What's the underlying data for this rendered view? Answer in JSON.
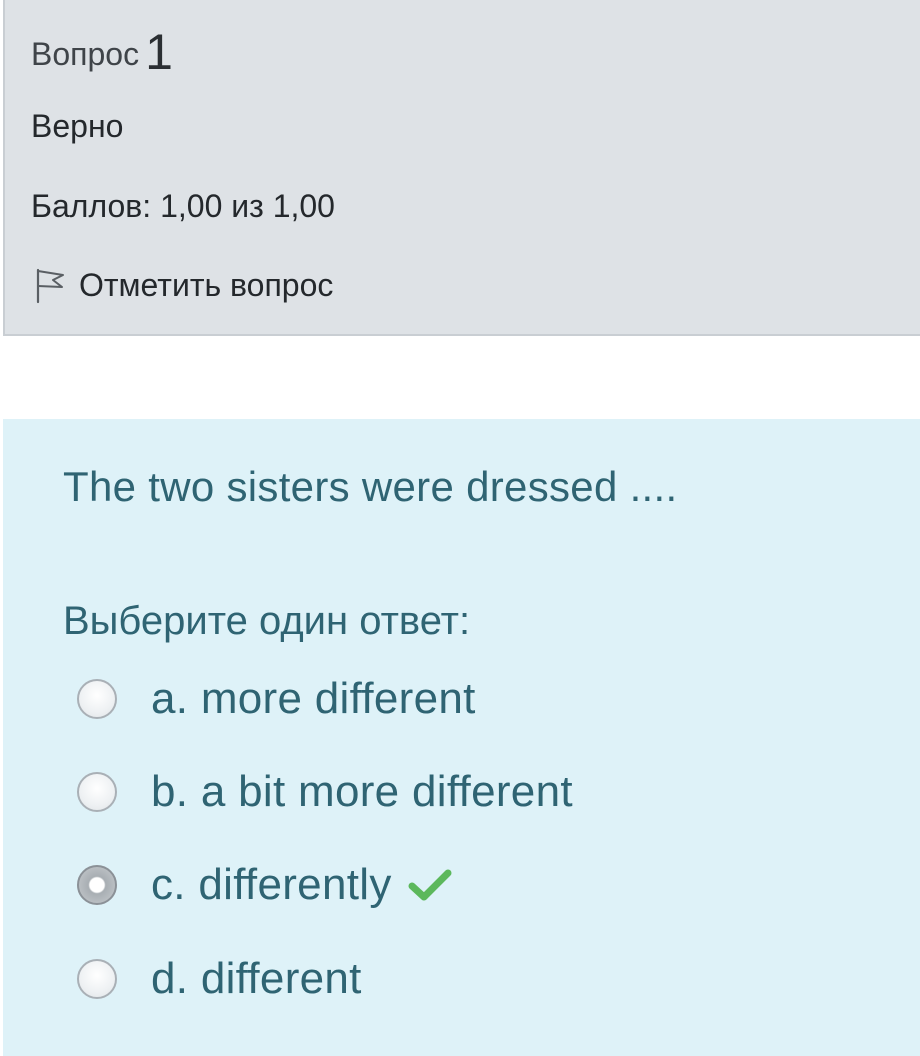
{
  "info": {
    "question_label": "Вопрос",
    "question_number": "1",
    "state": "Верно",
    "grade": "Баллов: 1,00 из 1,00",
    "flag_label": "Отметить вопрос",
    "flag_icon": "flag-icon"
  },
  "formulation": {
    "question_text": "The two sisters were dressed ....",
    "prompt": "Выберите один ответ:",
    "answers": [
      {
        "label": "a. more different",
        "selected": false,
        "correct": false
      },
      {
        "label": "b. a bit more different",
        "selected": false,
        "correct": false
      },
      {
        "label": "c. differently",
        "selected": true,
        "correct": true,
        "feedback_icon": "check-icon"
      },
      {
        "label": "d. different",
        "selected": false,
        "correct": false
      }
    ]
  },
  "colors": {
    "info_background": "#dee2e6",
    "formulation_background": "#def2f8",
    "question_text": "#2f6473",
    "correct_check": "#5cb85c"
  }
}
